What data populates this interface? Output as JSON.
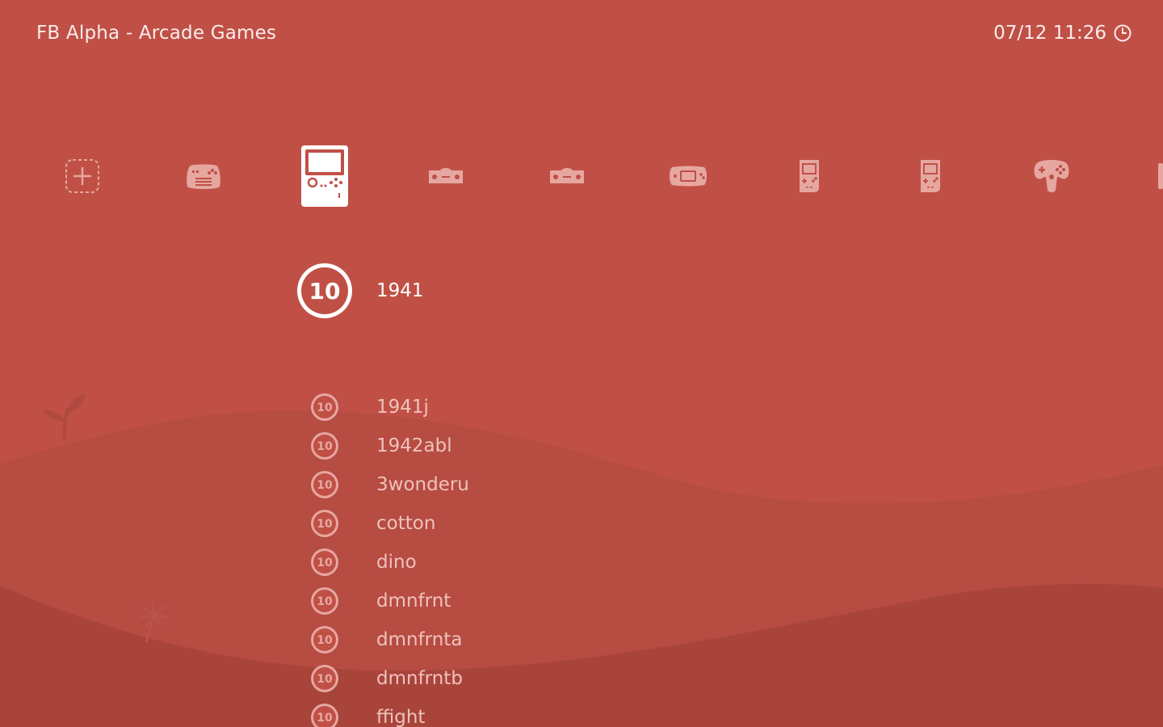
{
  "header": {
    "title": "FB Alpha - Arcade Games",
    "clock": "07/12 11:26",
    "clock_icon": "clock-icon"
  },
  "theme": {
    "background": "#c05046",
    "hill_light": "#b64c42",
    "hill_dark": "#a9443b",
    "accent": "#ffffff"
  },
  "tabs": [
    {
      "icon": "add-playlist-icon",
      "selected": false
    },
    {
      "icon": "gamepad-keyboard-icon",
      "selected": false
    },
    {
      "icon": "handheld-console-icon",
      "selected": true
    },
    {
      "icon": "sega-genesis-icon",
      "selected": false
    },
    {
      "icon": "sega-genesis-icon",
      "selected": false
    },
    {
      "icon": "game-boy-advance-icon",
      "selected": false
    },
    {
      "icon": "game-boy-icon",
      "selected": false
    },
    {
      "icon": "game-boy-color-icon",
      "selected": false
    },
    {
      "icon": "n64-controller-icon",
      "selected": false
    }
  ],
  "selected_entry": {
    "badge": "10",
    "label": "1941"
  },
  "list": {
    "badge": "10",
    "items": [
      "1941j",
      "1942abl",
      "3wonderu",
      "cotton",
      "dino",
      "dmnfrnt",
      "dmnfrnta",
      "dmnfrntb",
      "ffight"
    ]
  }
}
